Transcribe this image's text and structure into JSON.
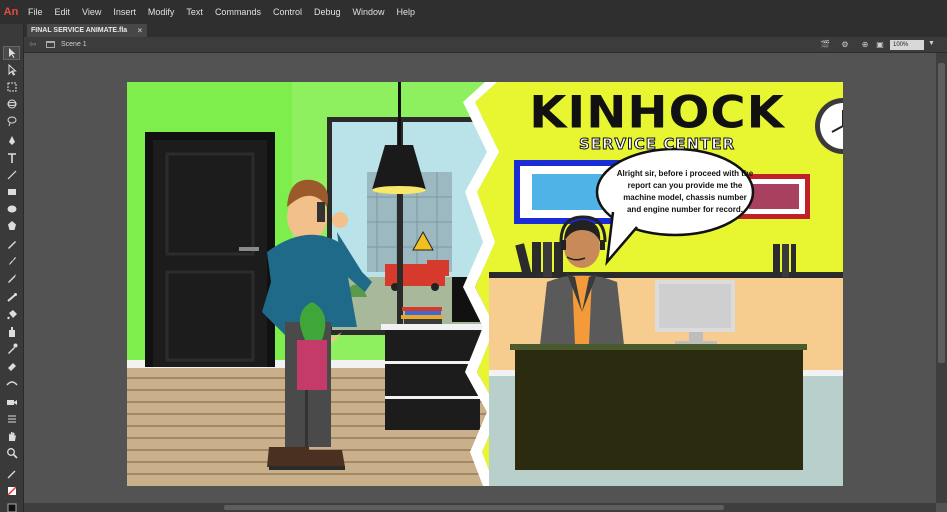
{
  "app": {
    "logo_text": "An"
  },
  "menu": [
    "File",
    "Edit",
    "View",
    "Insert",
    "Modify",
    "Text",
    "Commands",
    "Control",
    "Debug",
    "Window",
    "Help"
  ],
  "document": {
    "tab_title": "FINAL SERVICE ANIMATE.fla",
    "close_glyph": "×"
  },
  "editbar": {
    "scene_label": "Scene 1",
    "zoom": "100%"
  },
  "tools": [
    "selection-tool",
    "subselection-tool",
    "free-transform-tool",
    "3d-rotation-tool",
    "lasso-tool",
    "pen-tool",
    "text-tool",
    "line-tool",
    "rectangle-tool",
    "oval-tool",
    "polystar-tool",
    "pencil-tool",
    "paint-brush-tool",
    "brush-tool",
    "bone-tool",
    "paint-bucket-tool",
    "ink-bottle-tool",
    "eyedropper-tool",
    "eraser-tool",
    "width-tool",
    "camera-tool",
    "asset-warp-tool",
    "hand-tool",
    "zoom-tool",
    "stroke-color",
    "fill-color",
    "swap-colors"
  ],
  "stage_art": {
    "title": "KINHOCK",
    "subtitle": "SERVICE CENTER",
    "speech_bubble": "Alright sir, before i proceed with the report can you provide me the machine model, chassis number and engine number for record."
  },
  "colors": {
    "menubar_bg": "#2f2f2f",
    "toolbar_bg": "#3a3a3a",
    "pasteboard_bg": "#535353",
    "wall_green": "#7dee4c",
    "wall_yellow": "#e8f531",
    "logo_red": "#e64c3c"
  }
}
